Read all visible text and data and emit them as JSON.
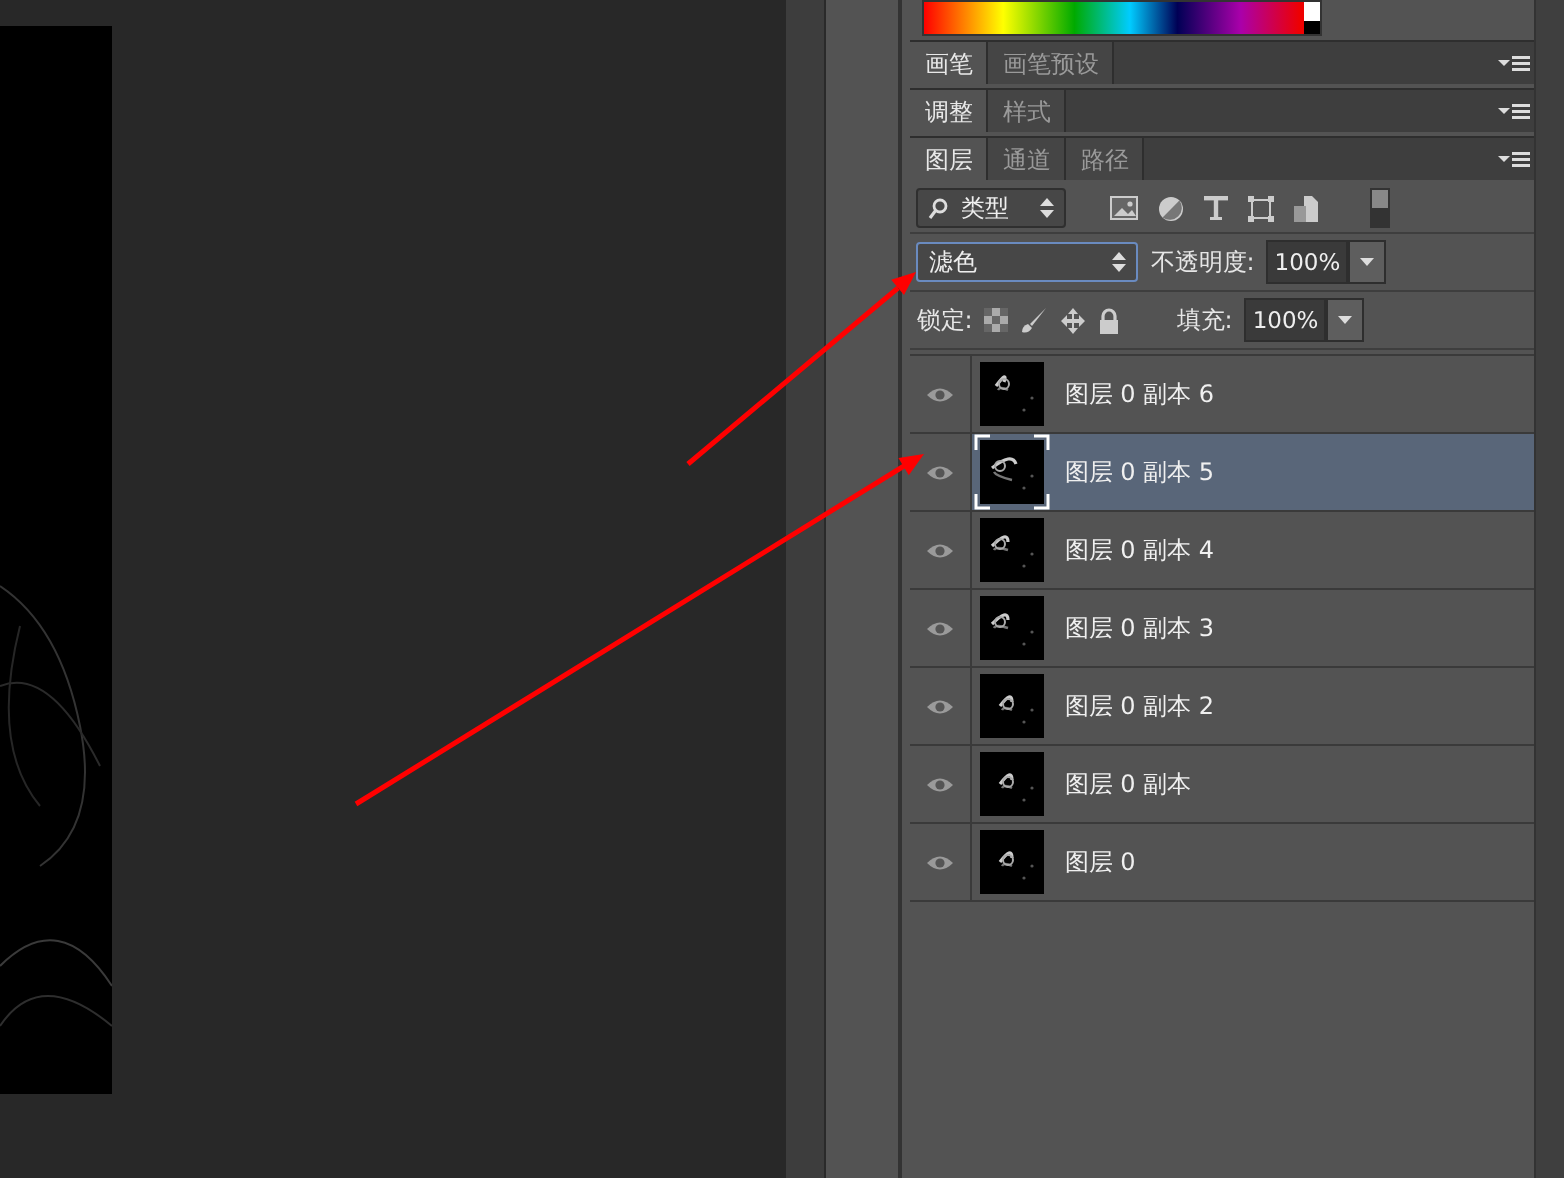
{
  "panel_groups": [
    {
      "tabs": [
        {
          "label": "画笔",
          "selected": true
        },
        {
          "label": "画笔预设",
          "selected": false
        }
      ]
    },
    {
      "tabs": [
        {
          "label": "调整",
          "selected": true
        },
        {
          "label": "样式",
          "selected": false
        }
      ]
    },
    {
      "tabs": [
        {
          "label": "图层",
          "selected": true
        },
        {
          "label": "通道",
          "selected": false
        },
        {
          "label": "路径",
          "selected": false
        }
      ]
    }
  ],
  "filter": {
    "label": "类型"
  },
  "blend_mode": {
    "value": "滤色"
  },
  "opacity": {
    "label": "不透明度:",
    "value": "100%"
  },
  "lock": {
    "label": "锁定:"
  },
  "fill": {
    "label": "填充:",
    "value": "100%"
  },
  "layers": [
    {
      "name": "图层 0 副本 6",
      "visible": true,
      "selected": false
    },
    {
      "name": "图层 0 副本 5",
      "visible": true,
      "selected": true
    },
    {
      "name": "图层 0 副本 4",
      "visible": true,
      "selected": false
    },
    {
      "name": "图层 0 副本 3",
      "visible": true,
      "selected": false
    },
    {
      "name": "图层 0 副本 2",
      "visible": true,
      "selected": false
    },
    {
      "name": "图层 0 副本",
      "visible": true,
      "selected": false
    },
    {
      "name": "图层 0",
      "visible": true,
      "selected": false
    }
  ]
}
